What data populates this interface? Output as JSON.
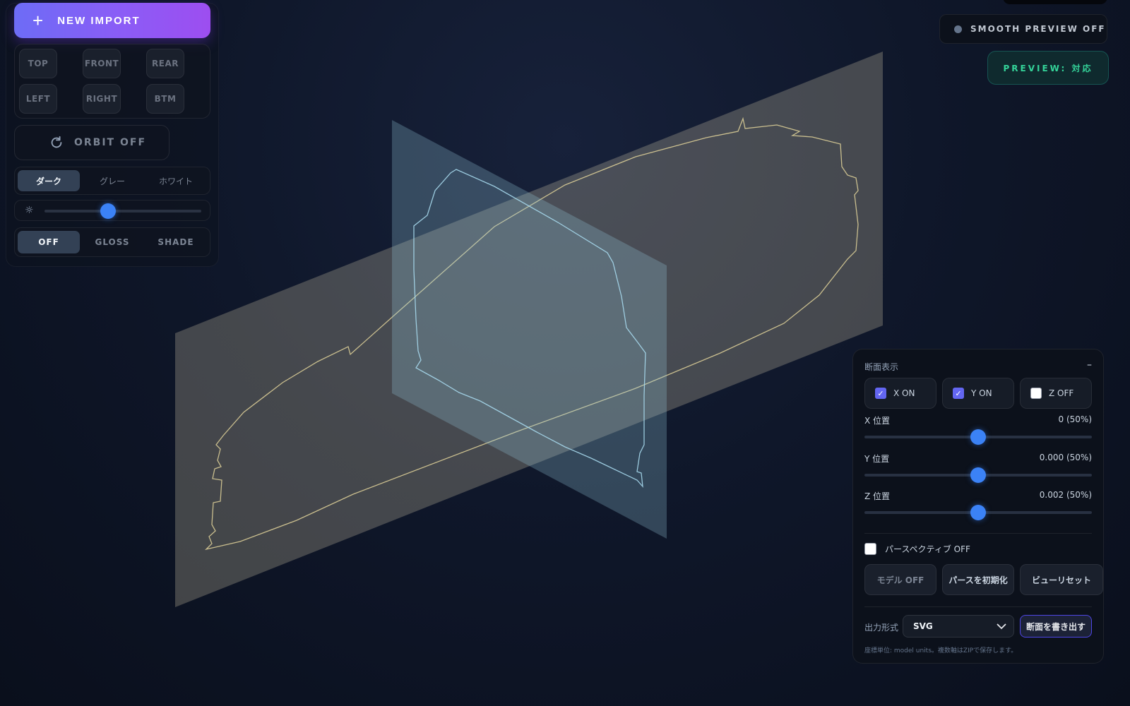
{
  "toolbar": {
    "new_import_label": "NEW IMPORT",
    "views": [
      "TOP",
      "FRONT",
      "REAR",
      "LEFT",
      "RIGHT",
      "BTM"
    ],
    "orbit_label": "ORBIT OFF",
    "themes": [
      "ダーク",
      "グレー",
      "ホワイト"
    ],
    "active_theme": "ダーク",
    "brightness_level_percent": 40,
    "render_modes": [
      "OFF",
      "GLOSS",
      "SHADE"
    ],
    "active_render_mode": "OFF"
  },
  "top_right": {
    "smooth_preview_label": "SMOOTH PREVIEW OFF",
    "preview_label": "PREVIEW: 対応"
  },
  "section_panel": {
    "title": "断面表示",
    "collapse_symbol": "–",
    "axes": [
      {
        "label": "X ON",
        "checked": true
      },
      {
        "label": "Y ON",
        "checked": true
      },
      {
        "label": "Z OFF",
        "checked": false
      }
    ],
    "sliders": [
      {
        "label": "X 位置",
        "value": "0 (50%)",
        "percent": 50
      },
      {
        "label": "Y 位置",
        "value": "0.000 (50%)",
        "percent": 50
      },
      {
        "label": "Z 位置",
        "value": "0.002 (50%)",
        "percent": 50
      }
    ],
    "perspective_label": "パースペクティブ OFF",
    "buttons": [
      "モデル OFF",
      "パースを初期化",
      "ビューリセット"
    ],
    "output_label": "出力形式",
    "output_format": "SVG",
    "export_label": "断面を書き出す",
    "note": "座標単位: model units。複数軸はZIPで保存します。"
  },
  "colors": {
    "accent": "#3b82f6",
    "import_gradient_start": "#6d6cf6",
    "import_gradient_end": "#9d4ef0",
    "preview_text": "#34d399",
    "plane_y": "#e7ddb6",
    "plane_x": "#93c5d8",
    "outline_y": "#e2d49a",
    "outline_x": "#a6d8ec"
  }
}
